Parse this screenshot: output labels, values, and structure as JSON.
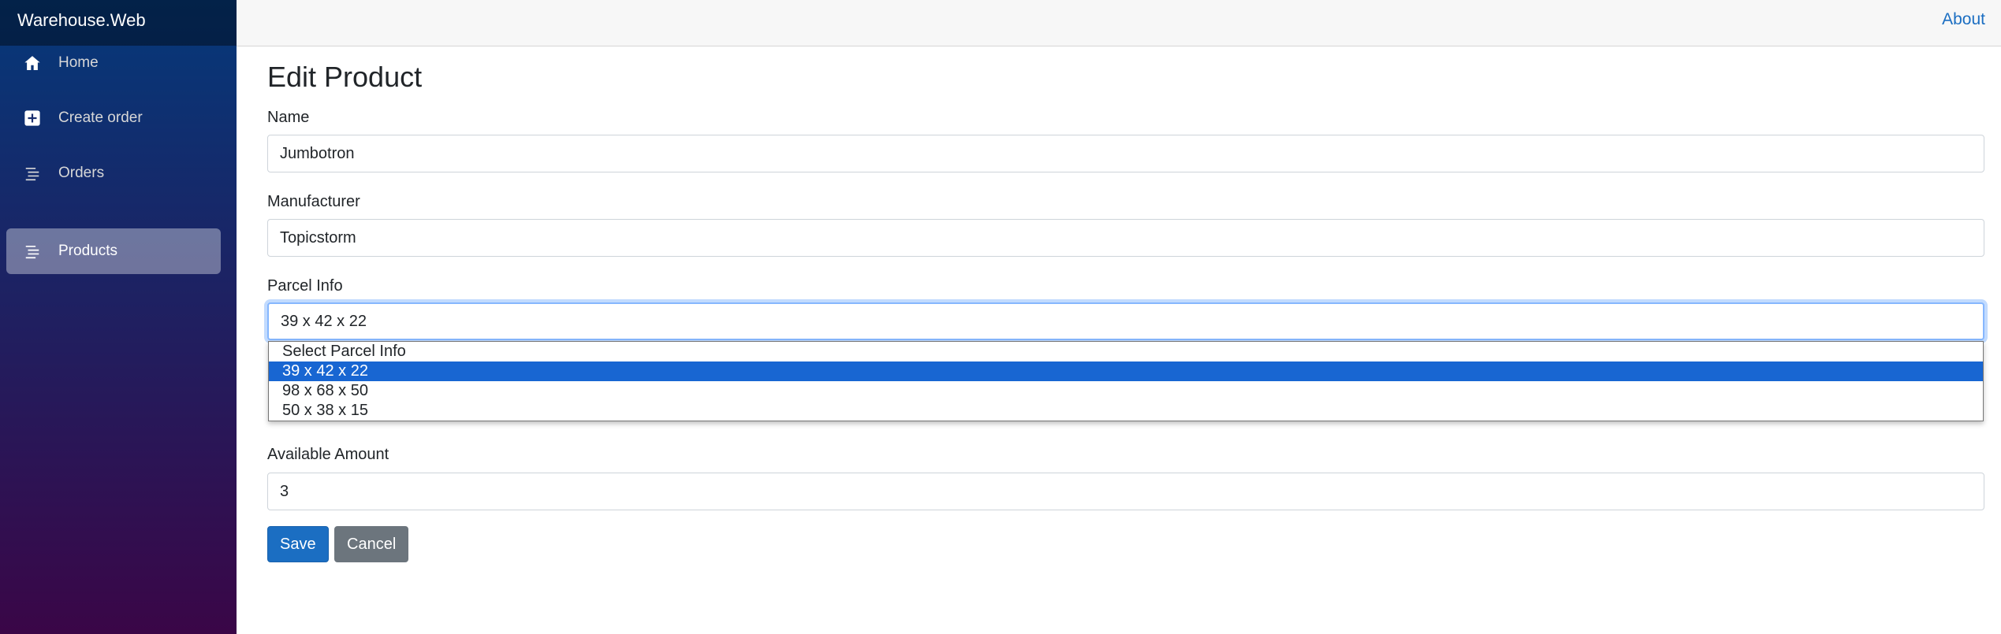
{
  "app": {
    "brand": "Warehouse.Web"
  },
  "sidebar": {
    "items": [
      {
        "label": "Home",
        "icon": "home-icon"
      },
      {
        "label": "Create order",
        "icon": "plus-square-icon"
      },
      {
        "label": "Orders",
        "icon": "list-icon"
      },
      {
        "label": "Products",
        "icon": "list-icon",
        "active": true
      }
    ]
  },
  "topbar": {
    "about_label": "About"
  },
  "form": {
    "title": "Edit Product",
    "name_label": "Name",
    "name_value": "Jumbotron",
    "manufacturer_label": "Manufacturer",
    "manufacturer_value": "Topicstorm",
    "parcel_label": "Parcel Info",
    "parcel_value": "39 x 42 x 22",
    "parcel_options": [
      "Select Parcel Info",
      "39 x 42 x 22",
      "98 x 68 x 50",
      "50 x 38 x 15"
    ],
    "amount_label": "Available Amount",
    "amount_value": "3",
    "save_label": "Save",
    "cancel_label": "Cancel"
  },
  "colors": {
    "accent": "#1b6ec2",
    "option_highlight": "#1866d2",
    "sidebar_top": "#05397a",
    "sidebar_bottom": "#3a0647"
  }
}
